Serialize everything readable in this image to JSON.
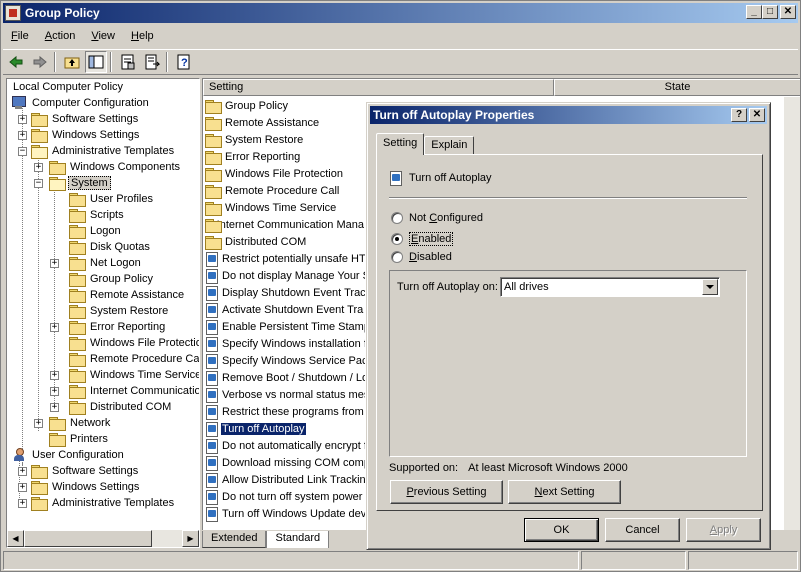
{
  "window": {
    "title": "Group Policy"
  },
  "menu": [
    {
      "pre": "",
      "key": "F",
      "post": "ile"
    },
    {
      "pre": "",
      "key": "A",
      "post": "ction"
    },
    {
      "pre": "",
      "key": "V",
      "post": "iew"
    },
    {
      "pre": "",
      "key": "H",
      "post": "elp"
    }
  ],
  "toolbar": {
    "icons": [
      "back-arrow-icon",
      "forward-arrow-icon",
      "up-folder-icon",
      "show-hide-tree-icon",
      "properties-icon",
      "export-list-icon",
      "help-icon"
    ]
  },
  "tree": {
    "root": "Local Computer Policy",
    "computer_config": "Computer Configuration",
    "cc_software": "Software Settings",
    "cc_windows": "Windows Settings",
    "cc_admin": "Administrative Templates",
    "windows_components": "Windows Components",
    "system": "System",
    "system_children": [
      "User Profiles",
      "Scripts",
      "Logon",
      "Disk Quotas",
      "Net Logon",
      "Group Policy",
      "Remote Assistance",
      "System Restore",
      "Error Reporting",
      "Windows File Protectio",
      "Remote Procedure Call",
      "Windows Time Service",
      "Internet Communicatio",
      "Distributed COM"
    ],
    "network": "Network",
    "printers": "Printers",
    "user_config": "User Configuration",
    "uc_software": "Software Settings",
    "uc_windows": "Windows Settings",
    "uc_admin": "Administrative Templates"
  },
  "list": {
    "col_setting": "Setting",
    "col_state": "State",
    "folders": [
      "Group Policy",
      "Remote Assistance",
      "System Restore",
      "Error Reporting",
      "Windows File Protection",
      "Remote Procedure Call",
      "Windows Time Service",
      "Internet Communication Mana",
      "Distributed COM"
    ],
    "settings": [
      "Restrict potentially unsafe HT",
      "Do not display Manage Your S",
      "Display Shutdown Event Track",
      "Activate Shutdown Event Tra",
      "Enable Persistent Time Stamp",
      "Specify Windows installation f",
      "Specify Windows Service Pack",
      "Remove Boot / Shutdown / Lo",
      "Verbose vs normal status mes",
      "Restrict these programs from",
      "Turn off Autoplay",
      "Do not automatically encrypt f",
      "Download missing COM compo",
      "Allow Distributed Link Tracking",
      "Do not turn off system power",
      "Turn off Windows Update dev"
    ],
    "selected": "Turn off Autoplay"
  },
  "bottom_tabs": [
    "Extended",
    "Standard"
  ],
  "dialog": {
    "title": "Turn off Autoplay Properties",
    "help_btn": "?",
    "close_btn": "✕",
    "tabs": [
      "Setting",
      "Explain"
    ],
    "policy_name": "Turn off Autoplay",
    "radios": [
      {
        "pre": "Not ",
        "key": "C",
        "post": "onfigured",
        "checked": false
      },
      {
        "pre": "",
        "key": "E",
        "post": "nabled",
        "checked": true
      },
      {
        "pre": "",
        "key": "D",
        "post": "isabled",
        "checked": false
      }
    ],
    "option_label": "Turn off Autoplay on:",
    "option_value": "All drives",
    "supported_label": "Supported on:",
    "supported_value": "At least Microsoft Windows 2000",
    "prev_btn": {
      "pre": "",
      "key": "P",
      "post": "revious Setting"
    },
    "next_btn": {
      "pre": "",
      "key": "N",
      "post": "ext Setting"
    },
    "ok": "OK",
    "cancel": "Cancel",
    "apply": {
      "pre": "",
      "key": "A",
      "post": "pply"
    }
  }
}
